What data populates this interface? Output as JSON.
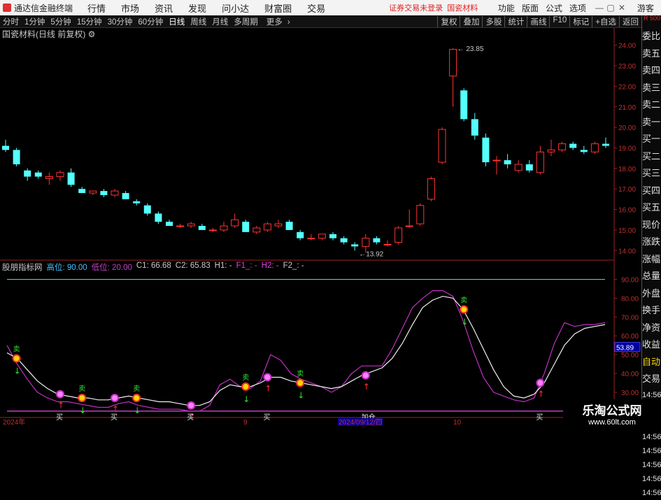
{
  "app": {
    "title": "通达信金融终端"
  },
  "menu": [
    "行情",
    "市场",
    "资讯",
    "发现",
    "问小达",
    "财富圈",
    "交易"
  ],
  "notice": "证券交易未登录",
  "stock_name_top": "国瓷材料",
  "right_menu": [
    "功能",
    "版面",
    "公式",
    "选项"
  ],
  "guest": "游客",
  "periods": [
    "分时",
    "1分钟",
    "5分钟",
    "15分钟",
    "30分钟",
    "60分钟",
    "日线",
    "周线",
    "月线",
    "多周期",
    "更多"
  ],
  "active_period": "日线",
  "right_tools": [
    "复权",
    "叠加",
    "多股",
    "统计",
    "画线",
    "F10",
    "标记",
    "+自选",
    "返回"
  ],
  "subhead": "国瓷材料(日线 前复权)",
  "indicator": {
    "name": "股朋指标网",
    "params": [
      {
        "label": "高位:",
        "value": "90.00",
        "color": "#40c0ff"
      },
      {
        "label": "低位:",
        "value": "20.00",
        "color": "#c040c0"
      },
      {
        "label": "C1:",
        "value": "66.68",
        "color": "#c8c8c8"
      },
      {
        "label": "C2:",
        "value": "65.83",
        "color": "#c8c8c8"
      },
      {
        "label": "H1:",
        "value": "-",
        "color": "#c8c8c8"
      },
      {
        "label": "F1_:",
        "value": "-",
        "color": "#e040e0"
      },
      {
        "label": "H2:",
        "value": "-",
        "color": "#e040e0"
      },
      {
        "label": "F2_:",
        "value": "-",
        "color": "#c8c8c8"
      }
    ]
  },
  "right_panel": [
    "委比",
    "卖五",
    "卖四",
    "卖三",
    "卖二",
    "卖一",
    "买一",
    "买二",
    "买三",
    "买四",
    "买五",
    "现价",
    "涨跌",
    "涨幅",
    "总量",
    "外盘",
    "换手",
    "净资",
    "收益",
    "自动",
    "交易",
    "14:56",
    "14:56",
    "14:56",
    "14:56",
    "14:56",
    "14:56",
    "14:56",
    "14:56"
  ],
  "right_panel_top": "R 500",
  "watermark": {
    "line1": "乐淘公式网",
    "line2": "www.60lt.com"
  },
  "chart_data": {
    "type": "candlestick",
    "price_ticks": [
      14.0,
      15.0,
      16.0,
      17.0,
      18.0,
      19.0,
      20.0,
      21.0,
      22.0,
      23.0,
      24.0
    ],
    "price_range": [
      13.6,
      24.5
    ],
    "price_label_high": "23.85",
    "price_label_low": "13.92",
    "indicator_ticks": [
      30.0,
      40.0,
      50.0,
      60.0,
      70.0,
      80.0,
      90.0
    ],
    "indicator_range": [
      17,
      95
    ],
    "current_value_label": "53.89",
    "date_labels": [
      "2024年",
      "9",
      "2024/09/12/四",
      "10"
    ],
    "candles": [
      {
        "o": 19.1,
        "h": 19.4,
        "l": 18.8,
        "c": 18.9
      },
      {
        "o": 18.9,
        "h": 19.0,
        "l": 18.1,
        "c": 18.2
      },
      {
        "o": 17.9,
        "h": 18.0,
        "l": 17.4,
        "c": 17.6
      },
      {
        "o": 17.8,
        "h": 17.9,
        "l": 17.5,
        "c": 17.6
      },
      {
        "o": 17.5,
        "h": 17.8,
        "l": 17.2,
        "c": 17.6
      },
      {
        "o": 17.6,
        "h": 17.9,
        "l": 17.4,
        "c": 17.8
      },
      {
        "o": 17.8,
        "h": 18.0,
        "l": 17.1,
        "c": 17.2
      },
      {
        "o": 17.0,
        "h": 17.1,
        "l": 16.8,
        "c": 16.8
      },
      {
        "o": 16.8,
        "h": 16.9,
        "l": 16.7,
        "c": 16.9
      },
      {
        "o": 16.9,
        "h": 17.0,
        "l": 16.6,
        "c": 16.7
      },
      {
        "o": 16.7,
        "h": 17.0,
        "l": 16.6,
        "c": 16.9
      },
      {
        "o": 16.8,
        "h": 16.9,
        "l": 16.5,
        "c": 16.5
      },
      {
        "o": 16.4,
        "h": 16.5,
        "l": 16.2,
        "c": 16.3
      },
      {
        "o": 16.2,
        "h": 16.3,
        "l": 15.7,
        "c": 15.8
      },
      {
        "o": 15.8,
        "h": 15.9,
        "l": 15.3,
        "c": 15.4
      },
      {
        "o": 15.4,
        "h": 15.5,
        "l": 15.2,
        "c": 15.2
      },
      {
        "o": 15.2,
        "h": 15.3,
        "l": 15.1,
        "c": 15.2
      },
      {
        "o": 15.2,
        "h": 15.4,
        "l": 15.1,
        "c": 15.3
      },
      {
        "o": 15.2,
        "h": 15.3,
        "l": 15.0,
        "c": 15.0
      },
      {
        "o": 15.0,
        "h": 15.1,
        "l": 14.9,
        "c": 15.0
      },
      {
        "o": 15.0,
        "h": 15.4,
        "l": 14.9,
        "c": 15.2
      },
      {
        "o": 15.2,
        "h": 15.8,
        "l": 15.1,
        "c": 15.5
      },
      {
        "o": 15.4,
        "h": 15.5,
        "l": 14.9,
        "c": 14.9
      },
      {
        "o": 14.9,
        "h": 15.2,
        "l": 14.8,
        "c": 15.1
      },
      {
        "o": 15.0,
        "h": 15.4,
        "l": 14.9,
        "c": 15.3
      },
      {
        "o": 15.2,
        "h": 15.5,
        "l": 15.1,
        "c": 15.3
      },
      {
        "o": 15.4,
        "h": 15.5,
        "l": 15.0,
        "c": 15.0
      },
      {
        "o": 14.9,
        "h": 15.0,
        "l": 14.5,
        "c": 14.6
      },
      {
        "o": 14.6,
        "h": 14.8,
        "l": 14.5,
        "c": 14.6
      },
      {
        "o": 14.6,
        "h": 14.8,
        "l": 14.5,
        "c": 14.8
      },
      {
        "o": 14.8,
        "h": 14.9,
        "l": 14.5,
        "c": 14.6
      },
      {
        "o": 14.6,
        "h": 14.7,
        "l": 14.3,
        "c": 14.4
      },
      {
        "o": 14.3,
        "h": 14.4,
        "l": 14.0,
        "c": 14.2
      },
      {
        "o": 14.2,
        "h": 14.8,
        "l": 13.9,
        "c": 14.6
      },
      {
        "o": 14.6,
        "h": 14.7,
        "l": 14.3,
        "c": 14.4
      },
      {
        "o": 14.3,
        "h": 14.5,
        "l": 14.2,
        "c": 14.3
      },
      {
        "o": 14.4,
        "h": 15.2,
        "l": 14.3,
        "c": 15.1
      },
      {
        "o": 15.2,
        "h": 16.0,
        "l": 15.1,
        "c": 15.2
      },
      {
        "o": 15.3,
        "h": 16.3,
        "l": 15.2,
        "c": 16.2
      },
      {
        "o": 16.5,
        "h": 17.6,
        "l": 16.4,
        "c": 17.5
      },
      {
        "o": 18.3,
        "h": 20.0,
        "l": 18.2,
        "c": 19.9
      },
      {
        "o": 22.5,
        "h": 23.85,
        "l": 21.0,
        "c": 23.8
      },
      {
        "o": 21.8,
        "h": 21.9,
        "l": 20.3,
        "c": 20.4
      },
      {
        "o": 20.4,
        "h": 20.7,
        "l": 19.4,
        "c": 19.6
      },
      {
        "o": 19.5,
        "h": 19.7,
        "l": 18.1,
        "c": 18.3
      },
      {
        "o": 18.4,
        "h": 18.6,
        "l": 17.7,
        "c": 18.4
      },
      {
        "o": 18.4,
        "h": 18.7,
        "l": 18.0,
        "c": 18.2
      },
      {
        "o": 17.9,
        "h": 18.4,
        "l": 17.8,
        "c": 18.2
      },
      {
        "o": 18.2,
        "h": 18.4,
        "l": 17.8,
        "c": 17.9
      },
      {
        "o": 17.8,
        "h": 19.1,
        "l": 17.7,
        "c": 18.8
      },
      {
        "o": 18.8,
        "h": 19.4,
        "l": 18.6,
        "c": 18.9
      },
      {
        "o": 18.9,
        "h": 19.3,
        "l": 18.8,
        "c": 19.2
      },
      {
        "o": 19.2,
        "h": 19.3,
        "l": 18.9,
        "c": 19.0
      },
      {
        "o": 18.9,
        "h": 19.1,
        "l": 18.7,
        "c": 18.8
      },
      {
        "o": 18.8,
        "h": 19.3,
        "l": 18.7,
        "c": 19.2
      },
      {
        "o": 19.2,
        "h": 19.5,
        "l": 19.0,
        "c": 19.1
      }
    ],
    "white_line": [
      51,
      48,
      42,
      36,
      32,
      29,
      28,
      27,
      27,
      26,
      26,
      27,
      28,
      27,
      26,
      25,
      25,
      24,
      23,
      23,
      25,
      31,
      34,
      33,
      33,
      35,
      38,
      38,
      36,
      35,
      34,
      33,
      32,
      33,
      36,
      39,
      41,
      43,
      48,
      56,
      66,
      75,
      79,
      81,
      80,
      74,
      64,
      53,
      42,
      33,
      28,
      27,
      29,
      35,
      45,
      55,
      61,
      64,
      65,
      66
    ],
    "purple_line": [
      55,
      45,
      37,
      30,
      27,
      25,
      25,
      24,
      23,
      22,
      22,
      24,
      25,
      23,
      22,
      21,
      21,
      21,
      20,
      20,
      23,
      34,
      37,
      33,
      32,
      36,
      50,
      47,
      40,
      37,
      35,
      33,
      30,
      33,
      40,
      44,
      44,
      44,
      53,
      64,
      75,
      80,
      84,
      84,
      81,
      68,
      52,
      38,
      30,
      28,
      26,
      25,
      27,
      40,
      56,
      67,
      65,
      66,
      66,
      67
    ],
    "high_level": 90,
    "low_level": 20,
    "signals": [
      {
        "i": 1,
        "type": "sell",
        "label": "卖"
      },
      {
        "i": 5,
        "type": "buy",
        "label": "买"
      },
      {
        "i": 7,
        "type": "sell",
        "label": "卖"
      },
      {
        "i": 10,
        "type": "buy",
        "label": "买"
      },
      {
        "i": 12,
        "type": "sell",
        "label": "卖"
      },
      {
        "i": 17,
        "type": "buy",
        "label": "买"
      },
      {
        "i": 22,
        "type": "sell",
        "label": "卖"
      },
      {
        "i": 24,
        "type": "buy",
        "label": "买"
      },
      {
        "i": 27,
        "type": "sell",
        "label": "卖"
      },
      {
        "i": 33,
        "type": "buy",
        "label": "加仓"
      },
      {
        "i": 42,
        "type": "sell",
        "label": "卖"
      },
      {
        "i": 49,
        "type": "buy",
        "label": "买"
      }
    ]
  }
}
